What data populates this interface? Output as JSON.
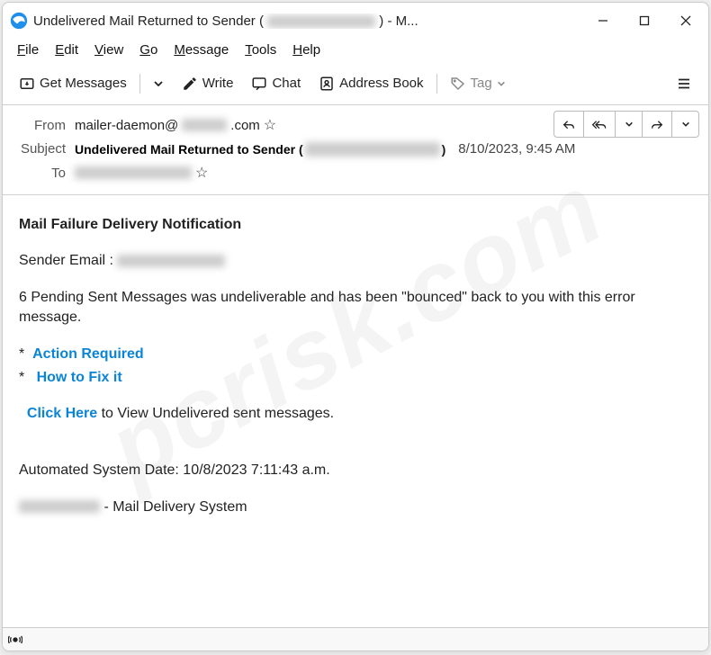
{
  "window": {
    "title_prefix": "Undelivered Mail Returned to Sender ( ",
    "title_suffix": " ) - M..."
  },
  "menubar": [
    "File",
    "Edit",
    "View",
    "Go",
    "Message",
    "Tools",
    "Help"
  ],
  "toolbar": {
    "get_messages": "Get Messages",
    "write": "Write",
    "chat": "Chat",
    "address_book": "Address Book",
    "tag": "Tag"
  },
  "headers": {
    "from_label": "From",
    "from_value_prefix": "mailer-daemon@",
    "from_value_suffix": ".com",
    "subject_label": "Subject",
    "subject_prefix": "Undelivered Mail Returned to Sender ( ",
    "subject_suffix": " )",
    "date": "8/10/2023, 9:45 AM",
    "to_label": "To"
  },
  "body": {
    "heading": "Mail Failure Delivery Notification",
    "sender_email_label": "Sender Email :  ",
    "pending_text": "6  Pending Sent Messages was undeliverable and has been \"bounced\" back to you with this error message.",
    "action_required": "Action Required",
    "how_to_fix": "How to Fix it",
    "click_here": "Click Here",
    "click_suffix": "  to View Undelivered sent messages.",
    "auto_date": "Automated System Date: 10/8/2023 7:11:43 a.m.",
    "mds_suffix": " - Mail Delivery System"
  },
  "watermark": "pcrisk.com"
}
